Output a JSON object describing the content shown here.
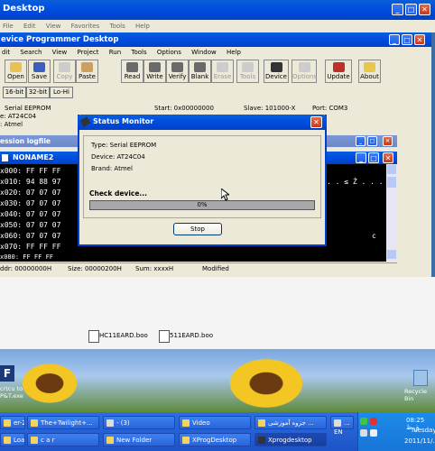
{
  "outer_window": {
    "title": "Desktop",
    "menu": [
      "File",
      "Edit",
      "View",
      "Favorites",
      "Tools",
      "Help"
    ]
  },
  "app": {
    "title": "evice Programmer Desktop",
    "menu": [
      "dit",
      "Search",
      "View",
      "Project",
      "Run",
      "Tools",
      "Options",
      "Window",
      "Help"
    ],
    "toolbar": [
      "Open",
      "Save",
      "Copy",
      "Paste",
      "Read",
      "Write",
      "Verify",
      "Blank",
      "Erase",
      "Tools",
      "Device",
      "Options",
      "Update",
      "About"
    ],
    "toolbar_disabled": [
      "Copy",
      "Erase",
      "Tools",
      "Options"
    ],
    "bit_buttons": [
      "16-bit",
      "32-bit",
      "Lo-Hi"
    ],
    "info": {
      "device": "Serial EEPROM",
      "chip": "e: AT24C04",
      "brand": ": Atmel",
      "start": "Start: 0x00000000",
      "slave": "Slave: 101000-X",
      "port": "Port: COM3"
    }
  },
  "logwin": {
    "title": "ession logfile"
  },
  "hexwin": {
    "title": "NONAME2",
    "rows": [
      "x000: FF FF FF",
      "x010: 94 88 97",
      "x020: 07 07 07",
      "x030: 07 07 07",
      "x040: 07 07 07",
      "x050: 07 07 07",
      "x060: 07 07 07",
      "x070: FF FF FF",
      "x080: FF FF FF"
    ],
    "ascii_rows": [
      ". . ≤ Ż . . .",
      ". . ≤ Ż . . .",
      "",
      "",
      "",
      "",
      "c",
      "",
      ""
    ],
    "status": {
      "addr": "ddr: 00000000H",
      "size": "Size: 00000200H",
      "sum": "Sum: xxxxH",
      "state": "Modified"
    }
  },
  "dialog": {
    "title": "Status Monitor",
    "type": "Type: Serial EEPROM",
    "device": "Device: AT24C04",
    "brand": "Brand: Atmel",
    "check": "Check device...",
    "progress_text": "0%",
    "progress": 0,
    "stop": "Stop"
  },
  "desktop": {
    "files": [
      "HC11EARD.boo",
      "511EARD.boo"
    ],
    "left_icon_label": "crtcu to\nP&T.exe",
    "recycle": "Recycle Bin"
  },
  "taskbar": {
    "row1": [
      "er-2...",
      "The+Twilight+...",
      "- (3)",
      "Video",
      "جزوه آموزشی ...",
      "..."
    ],
    "row2": [
      "Loaded...",
      "c a r",
      "New Folder",
      "XProgDesktop",
      "Xprogdesktop"
    ],
    "lang": "EN",
    "time": "08:25 ق.ظ",
    "day": "Tuesday",
    "date": "2011/11/..."
  }
}
